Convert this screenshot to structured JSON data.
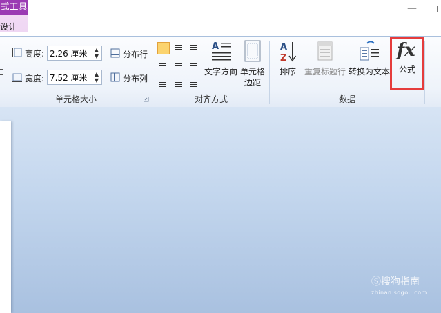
{
  "context_tab": {
    "header": "式工具",
    "active_tab": "设计"
  },
  "window": {
    "minimize": "—"
  },
  "cell_size_group": {
    "label": "单元格大小",
    "height_label": "高度:",
    "height_value": "2.26 厘米",
    "width_label": "宽度:",
    "width_value": "7.52 厘米",
    "distribute_rows": "分布行",
    "distribute_cols": "分布列"
  },
  "alignment_group": {
    "label": "对齐方式",
    "text_direction": "文字方向",
    "cell_margins_line1": "单元格",
    "cell_margins_line2": "边距"
  },
  "data_group": {
    "label": "数据",
    "sort": "排序",
    "repeat_header": "重复标题行",
    "convert_to_text": "转换为文本",
    "formula": "公式",
    "formula_glyph": "fx"
  },
  "watermark": {
    "main": "搜狗指南",
    "sub": "zhinan.sogou.com"
  },
  "colors": {
    "context_accent": "#9b3bb3",
    "highlight_box": "#e53c3c",
    "selected_button": "#fbd36e"
  }
}
